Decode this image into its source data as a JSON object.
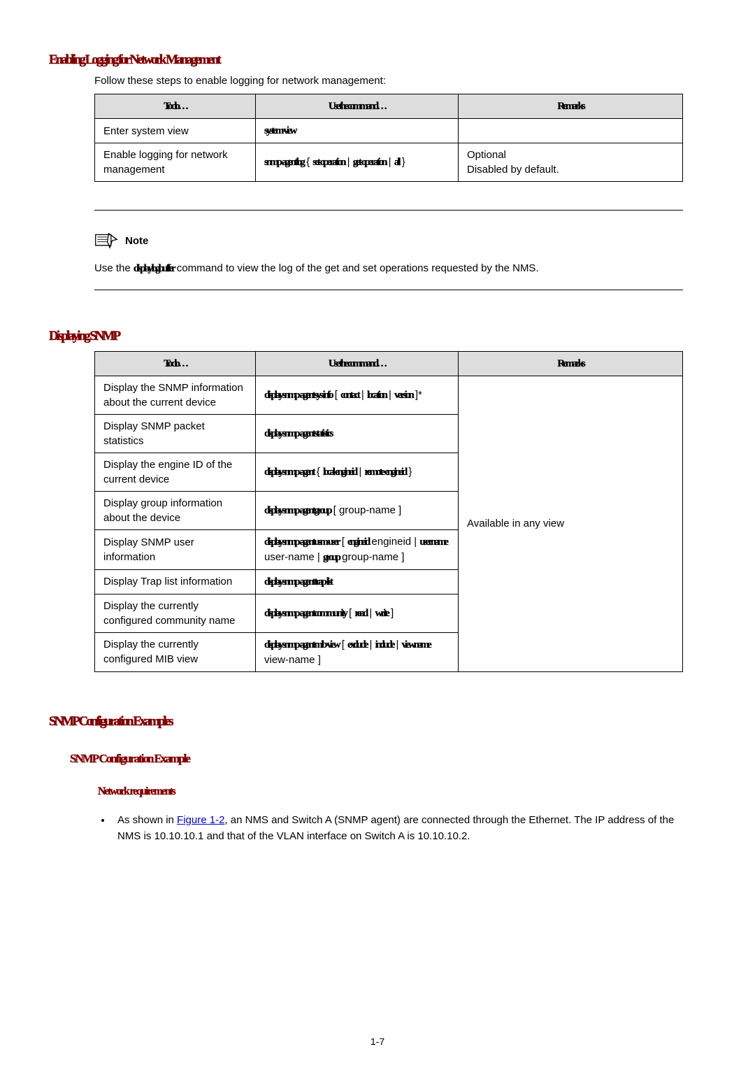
{
  "s1": {
    "title": "Enabling Logging for Network Management",
    "intro": "Follow these steps to enable logging for network management:",
    "table": {
      "headers": {
        "c1": "To do…",
        "c2": "Use the command…",
        "c3": "Remarks"
      },
      "rows": [
        {
          "c1": "Enter system view",
          "c2_cmd": "system-view",
          "c3": ""
        },
        {
          "c1": "Enable logging for network management",
          "c2_cmd_a": "snmp-agent log",
          "c2_txt_a": " { ",
          "c2_cmd_b": "set-operation",
          "c2_txt_b": " | ",
          "c2_cmd_c": "get-operation",
          "c2_txt_c": " | ",
          "c2_cmd_d": "all",
          "c2_txt_d": " }",
          "c3a": "Optional",
          "c3b": "Disabled by default."
        }
      ]
    }
  },
  "note": {
    "label": "Note",
    "text_a": "Use the ",
    "text_cmd": "display logbuffer",
    "text_b": " command to view the log of the get and set operations requested by the NMS."
  },
  "s2": {
    "title": "Displaying SNMP",
    "table": {
      "headers": {
        "c1": "To do…",
        "c2": "Use the command…",
        "c3": "Remarks"
      },
      "r1": {
        "c1": "Display the SNMP information about the current device",
        "c2_cmd_a": "display snmp-agent sys-info",
        "c2_txt_a": " [ ",
        "c2_cmd_b": "contact",
        "c2_txt_b": " | ",
        "c2_cmd_c": "location",
        "c2_txt_c": " | ",
        "c2_cmd_d": "version",
        "c2_txt_d": " ]*"
      },
      "r2": {
        "c1": "Display SNMP packet statistics",
        "c2_cmd": "display snmp-agent statistics"
      },
      "r3": {
        "c1": "Display the engine ID of the current device",
        "c2_cmd_a": "display snmp-agent",
        "c2_txt_a": " { ",
        "c2_cmd_b": "local-engineid",
        "c2_txt_b": " | ",
        "c2_cmd_c": "remote-engineid",
        "c2_txt_c": " }"
      },
      "r4": {
        "c1": "Display group information about the device",
        "c2_cmd_a": "display snmp-agent group",
        "c2_txt_a": " [ group-name ]"
      },
      "r5": {
        "c1": "Display SNMP user information",
        "c2_cmd_a": "display snmp-agent usm-user",
        "c2_txt_a": " [ ",
        "c2_cmd_b": "engineid",
        "c2_txt_b": " engineid | ",
        "c2_cmd_c": "username",
        "c2_txt_c": " user-name | ",
        "c2_cmd_d": "group",
        "c2_txt_d": " group-name ]"
      },
      "r6": {
        "c1": "Display Trap list information",
        "c2_cmd": "display snmp-agent trap-list"
      },
      "r7": {
        "c1": "Display the currently configured community name",
        "c2_cmd_a": "display snmp-agent community",
        "c2_txt_a": " [ ",
        "c2_cmd_b": "read",
        "c2_txt_b": " | ",
        "c2_cmd_c": "write",
        "c2_txt_c": " ]"
      },
      "r8": {
        "c1": "Display the currently configured MIB view",
        "c2_cmd_a": "display snmp-agent mib-view",
        "c2_txt_a": " [ ",
        "c2_cmd_b": "exclude",
        "c2_txt_b": " | ",
        "c2_cmd_c": "include",
        "c2_txt_c": " | ",
        "c2_cmd_d": "viewname",
        "c2_txt_d": " view-name ]"
      },
      "remarks": "Available in any view"
    }
  },
  "s3": {
    "title": "SNMP Configuration Examples",
    "sub1": "SNMP Configuration Example",
    "req": "Network requirements",
    "bullet1_a": "As shown in ",
    "bullet1_link": "Figure 1-2",
    "bullet1_b": ", an NMS and Switch A (SNMP agent) are connected through the Ethernet. The IP address of the NMS is 10.10.10.1 and that of the VLAN interface on Switch A is 10.10.10.2."
  },
  "page_num": "1-7"
}
